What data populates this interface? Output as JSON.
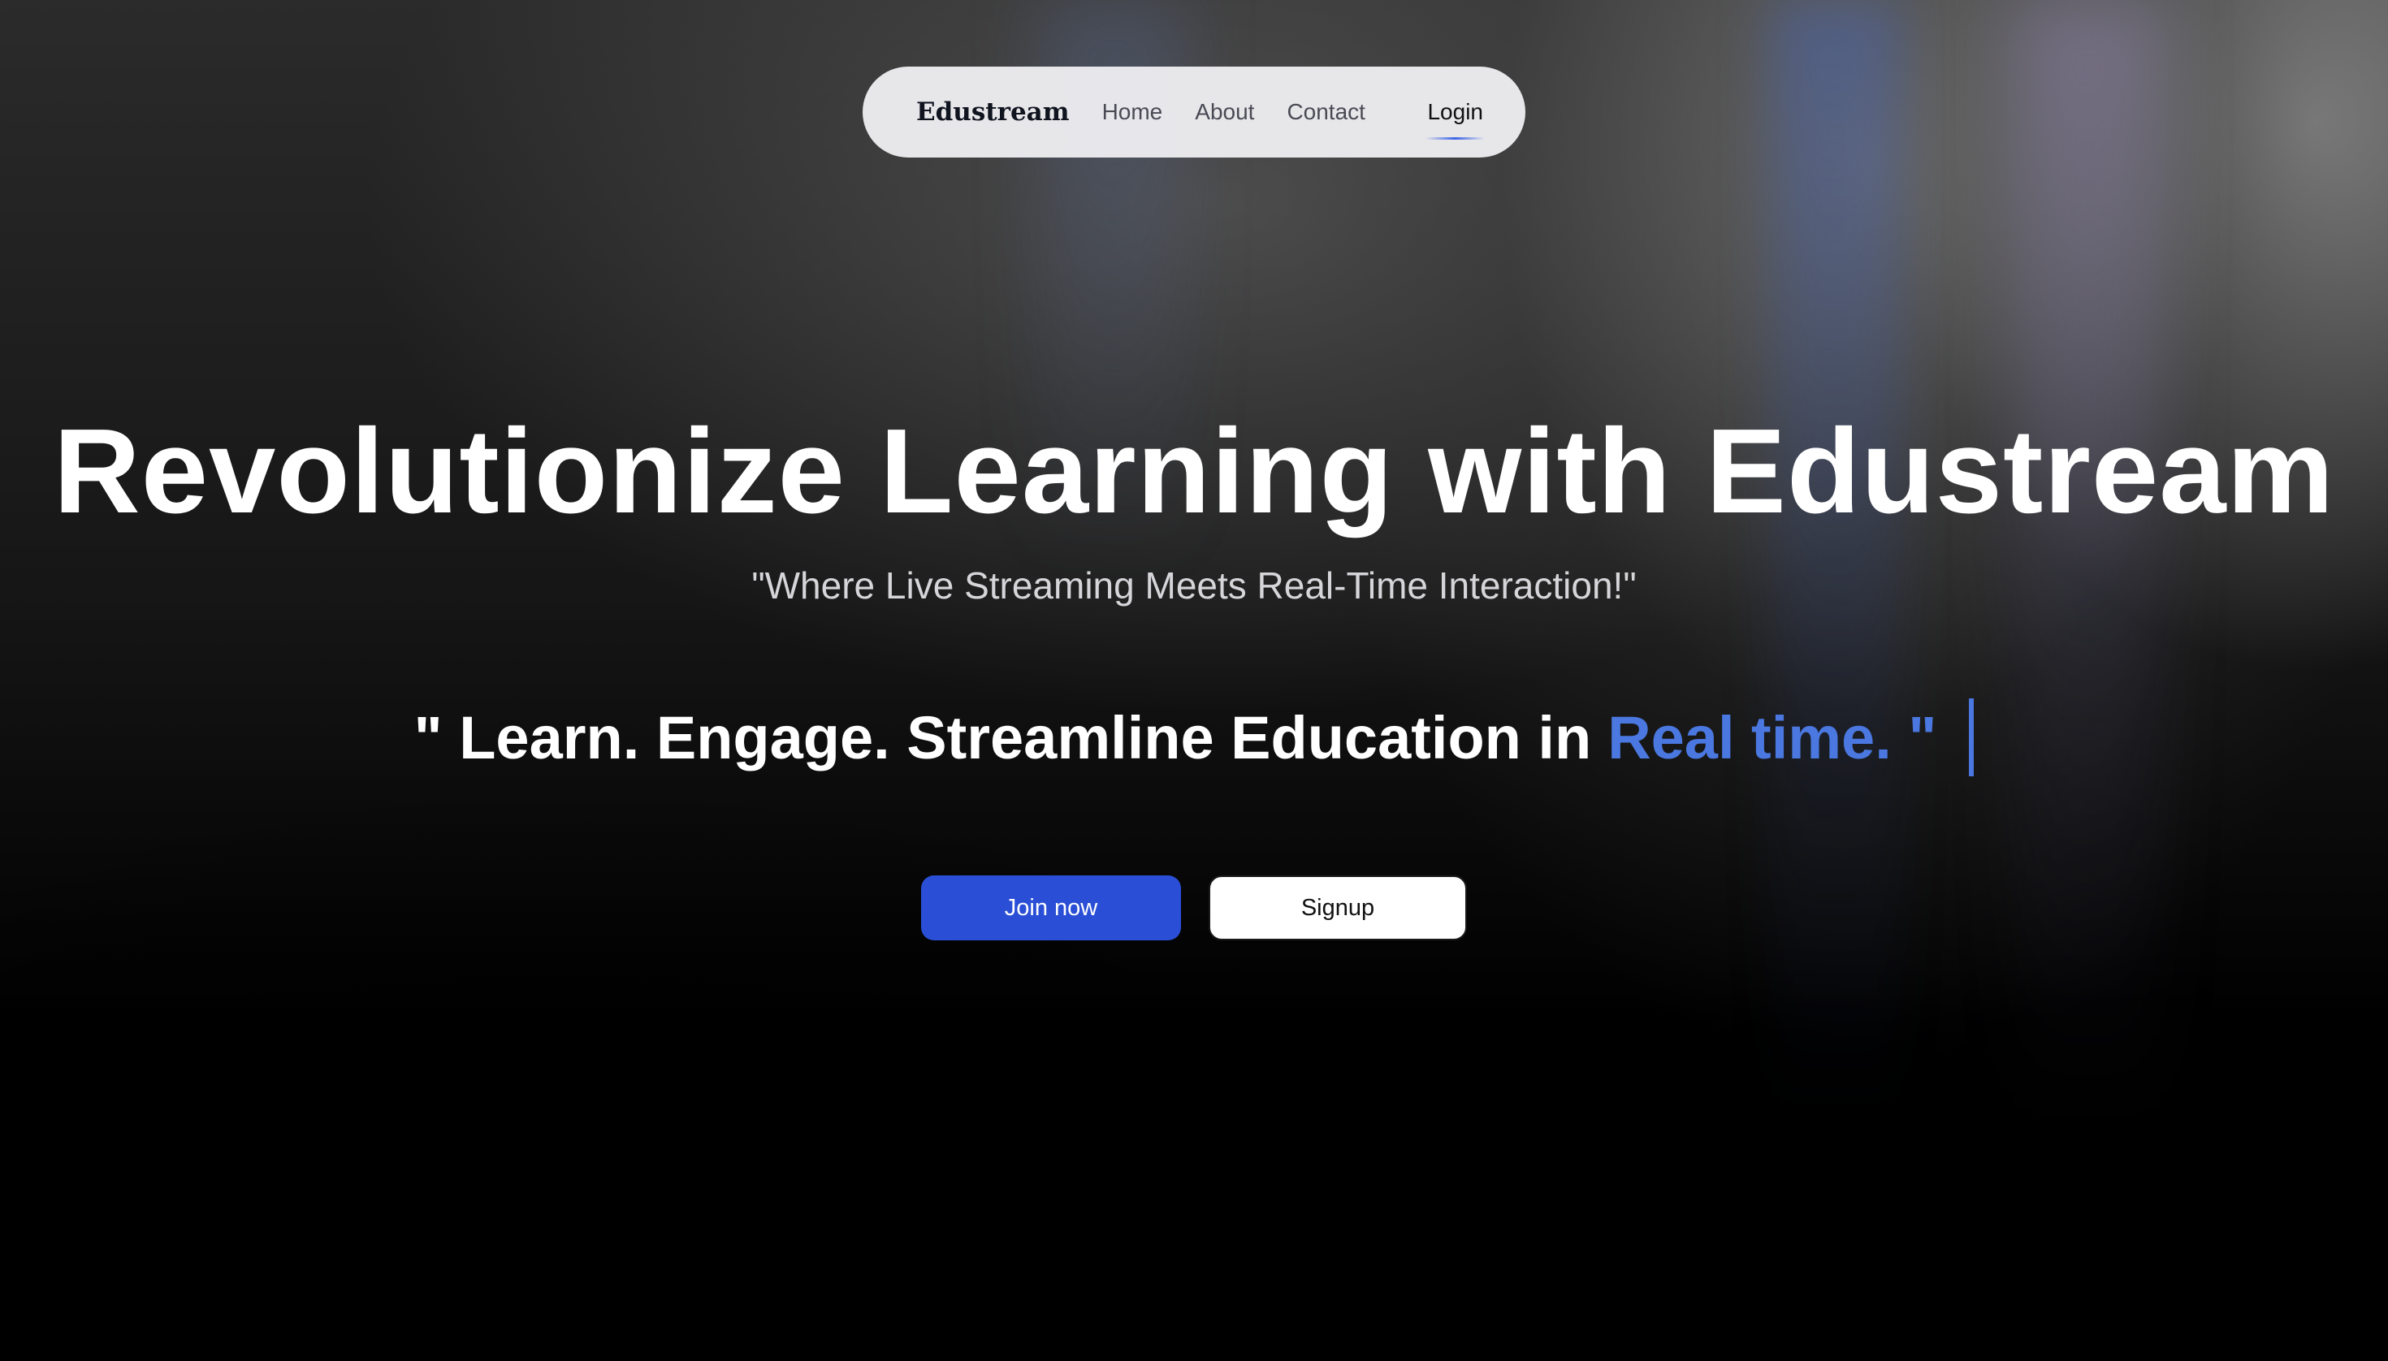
{
  "navbar": {
    "brand": "Edustream",
    "links": [
      "Home",
      "About",
      "Contact"
    ],
    "login_label": "Login"
  },
  "hero": {
    "title": "Revolutionize Learning with Edustream",
    "subtitle": "\"Where Live Streaming Meets Real-Time Interaction!\"",
    "tagline_main": "\" Learn. Engage. Streamline Education in",
    "tagline_accent": "Real time. \""
  },
  "actions": {
    "join_label": "Join now",
    "signup_label": "Signup"
  },
  "colors": {
    "accent": "#4a78e0",
    "primary_button": "#2a4fd6",
    "navbar_bg": "#ececf0"
  }
}
